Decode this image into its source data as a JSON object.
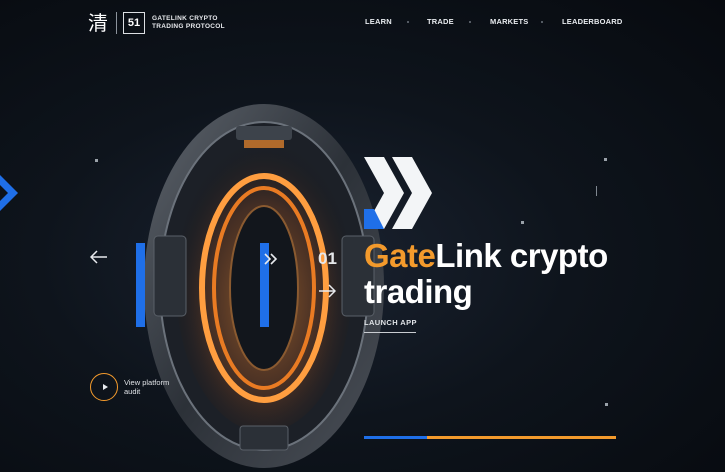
{
  "header": {
    "logo_glyph": "清",
    "logo_box": "51",
    "logo_line1": "GATELINK CRYPTO",
    "logo_line2": "TRADING PROTOCOL",
    "nav": [
      {
        "label": "LEARN"
      },
      {
        "label": "TRADE"
      },
      {
        "label": "MARKETS"
      },
      {
        "label": "LEADERBOARD"
      }
    ]
  },
  "hero": {
    "slide_number": "01",
    "headline_accent": "Gate",
    "headline_rest": "Link crypto",
    "headline_line2": "trading",
    "cta_label": "LAUNCH APP",
    "video_label": "View platform audit"
  },
  "slider": {
    "progress_blue_fraction": 0.25,
    "progress_orange_fraction": 0.75
  },
  "colors": {
    "accent_orange": "#f39a2c",
    "accent_blue": "#1f6fe8",
    "background": "#0b1016"
  }
}
